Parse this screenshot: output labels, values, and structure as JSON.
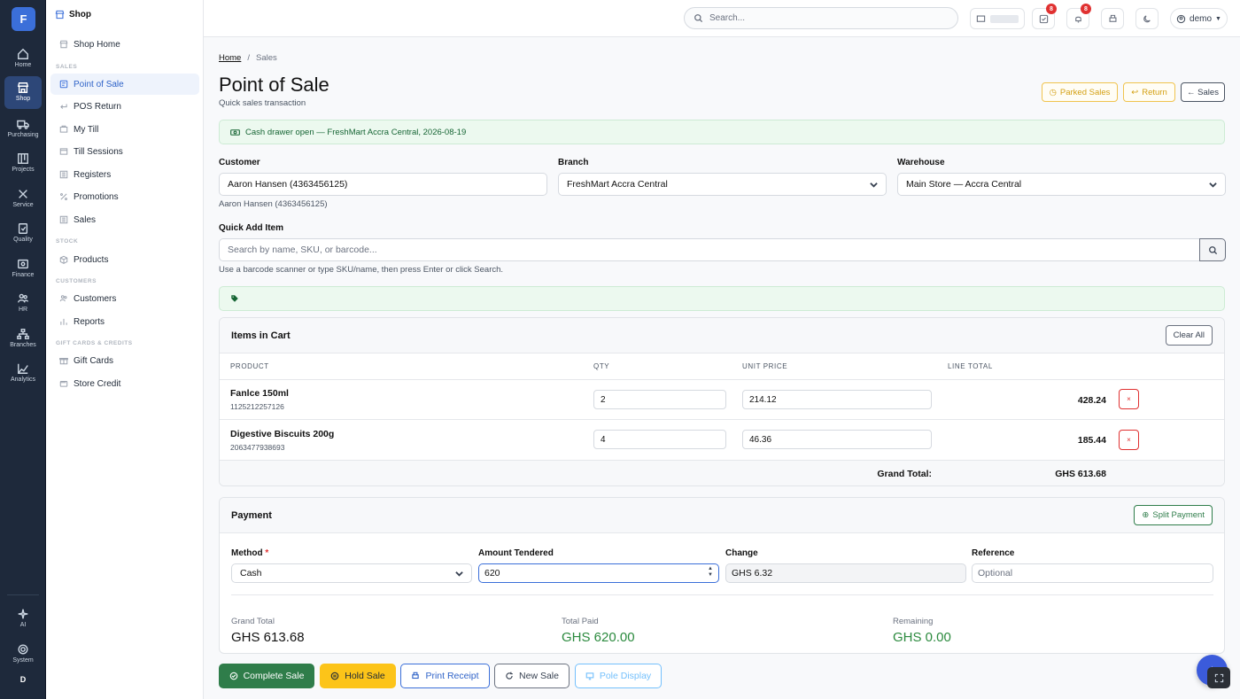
{
  "rail": {
    "logo": "F",
    "items": [
      {
        "label": "Home",
        "icon": "home-icon"
      },
      {
        "label": "Shop",
        "icon": "shop-icon"
      },
      {
        "label": "Purchasing",
        "icon": "truck-icon"
      },
      {
        "label": "Projects",
        "icon": "projects-icon"
      },
      {
        "label": "Service",
        "icon": "wrench-icon"
      },
      {
        "label": "Quality",
        "icon": "clipboard-icon"
      },
      {
        "label": "Finance",
        "icon": "finance-icon"
      },
      {
        "label": "HR",
        "icon": "people-icon"
      },
      {
        "label": "Branches",
        "icon": "branches-icon"
      },
      {
        "label": "Analytics",
        "icon": "chart-icon"
      }
    ],
    "bottom": [
      {
        "label": "AI",
        "icon": "sparkle-icon"
      },
      {
        "label": "System",
        "icon": "gear-icon"
      }
    ],
    "user_initial": "D"
  },
  "sidebar": {
    "title": "Shop",
    "home": "Shop Home",
    "sections": [
      {
        "title": "SALES",
        "items": [
          "Point of Sale",
          "POS Return",
          "My Till",
          "Till Sessions",
          "Registers",
          "Promotions",
          "Sales"
        ]
      },
      {
        "title": "STOCK",
        "items": [
          "Products"
        ]
      },
      {
        "title": "CUSTOMERS",
        "items": [
          "Customers",
          "Reports"
        ]
      },
      {
        "title": "GIFT CARDS & CREDITS",
        "items": [
          "Gift Cards",
          "Store Credit"
        ]
      }
    ]
  },
  "topbar": {
    "search_placeholder": "Search...",
    "tasks_badge": "8",
    "notifications_badge": "8",
    "user": "demo"
  },
  "page": {
    "breadcrumb": [
      "Home",
      "Sales"
    ],
    "title": "Point of Sale",
    "subtitle": "Quick sales transaction",
    "buttons": {
      "parked": "Parked Sales",
      "return": "Return",
      "sales": "← Sales"
    },
    "alert": "Cash drawer open — FreshMart Accra Central, 2026-08-19"
  },
  "form": {
    "customer_label": "Customer",
    "customer_value": "Aaron Hansen (4363456125)",
    "customer_hint": "Aaron Hansen (4363456125)",
    "branch_label": "Branch",
    "branch_value": "FreshMart Accra Central",
    "warehouse_label": "Warehouse",
    "warehouse_value": "Main Store — Accra Central",
    "quick_add_label": "Quick Add Item",
    "quick_add_placeholder": "Search by name, SKU, or barcode...",
    "quick_add_hint": "Use a barcode scanner or type SKU/name, then press Enter or click Search."
  },
  "cart": {
    "title": "Items in Cart",
    "clear_label": "Clear All",
    "headers": [
      "PRODUCT",
      "QTY",
      "UNIT PRICE",
      "LINE TOTAL"
    ],
    "rows": [
      {
        "name": "Fanlce 150ml",
        "sku": "1125212257126",
        "qty": "2",
        "price": "214.12",
        "total": "428.24"
      },
      {
        "name": "Digestive Biscuits 200g",
        "sku": "2063477938693",
        "qty": "4",
        "price": "46.36",
        "total": "185.44"
      }
    ],
    "remove_label": "×",
    "grand_total_label": "Grand Total:",
    "grand_total_value": "GHS 613.68"
  },
  "payment": {
    "title": "Payment",
    "split_label": "Split Payment",
    "method_label": "Method",
    "required_mark": "*",
    "method_value": "Cash",
    "tendered_label": "Amount Tendered",
    "tendered_value": "620",
    "change_label": "Change",
    "change_value": "GHS 6.32",
    "reference_label": "Reference",
    "reference_placeholder": "Optional",
    "summary": [
      {
        "label": "Grand Total",
        "value": "GHS 613.68",
        "color": "#111111"
      },
      {
        "label": "Total Paid",
        "value": "GHS 620.00",
        "color": "#2b8a3e"
      },
      {
        "label": "Remaining",
        "value": "GHS 0.00",
        "color": "#2b8a3e"
      }
    ]
  },
  "actions": {
    "complete": "Complete Sale",
    "hold": "Hold Sale",
    "print": "Print Receipt",
    "new": "New Sale",
    "pole": "Pole Display"
  },
  "colors": {
    "accent": "#3b6fd9",
    "success": "#2f7d4a",
    "warning": "#fcc419",
    "danger": "#e03131"
  }
}
